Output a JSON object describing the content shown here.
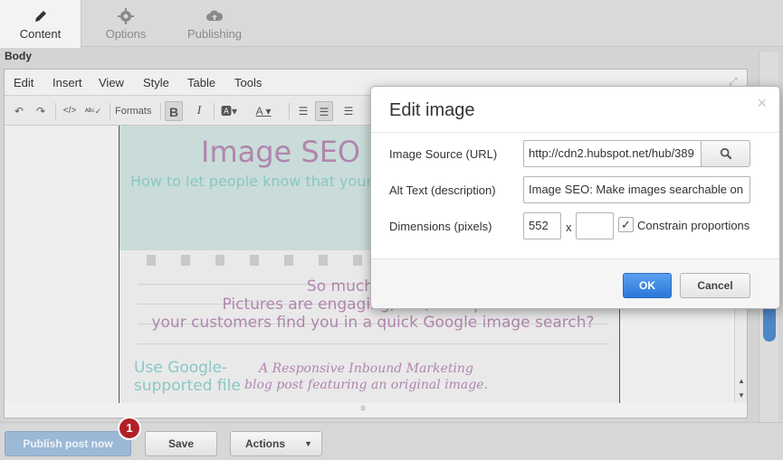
{
  "tabs": [
    {
      "label": "Content",
      "icon": "pencil-icon",
      "active": true
    },
    {
      "label": "Options",
      "icon": "gear-icon",
      "active": false
    },
    {
      "label": "Publishing",
      "icon": "cloud-icon",
      "active": false
    }
  ],
  "body_label": "Body",
  "menubar": [
    "Edit",
    "Insert",
    "View",
    "Style",
    "Table",
    "Tools"
  ],
  "toolbar": {
    "formats_label": "Formats",
    "bold_label": "B",
    "italic_label": "I"
  },
  "image_content": {
    "title": "Image SEO",
    "subtitle": "How to let people know that your images",
    "line1": "So much of online conte",
    "line2": "Pictures are engaging, fun, and quick. But can",
    "line3": "your customers find you in a quick Google image search?",
    "left1": "Use Google-",
    "left2": "supported file",
    "right1": "A Responsive Inbound Marketing",
    "right2": "blog post featuring an original image."
  },
  "modal": {
    "title": "Edit image",
    "close_symbol": "×",
    "source_label": "Image Source (URL)",
    "source_value": "http://cdn2.hubspot.net/hub/389",
    "alt_label": "Alt Text (description)",
    "alt_value": "Image SEO: Make images searchable on",
    "dimensions_label": "Dimensions (pixels)",
    "width_value": "552",
    "height_value": "",
    "x_separator": "x",
    "constrain_label": "Constrain proportions",
    "constrain_checked": "✓",
    "ok_label": "OK",
    "cancel_label": "Cancel"
  },
  "bottom": {
    "publish_label": "Publish post now",
    "badge_count": "1",
    "save_label": "Save",
    "actions_label": "Actions"
  },
  "colors": {
    "accent_blue": "#2c78d8",
    "scroll_blue": "#4c86c5",
    "badge_red": "#b22026"
  }
}
